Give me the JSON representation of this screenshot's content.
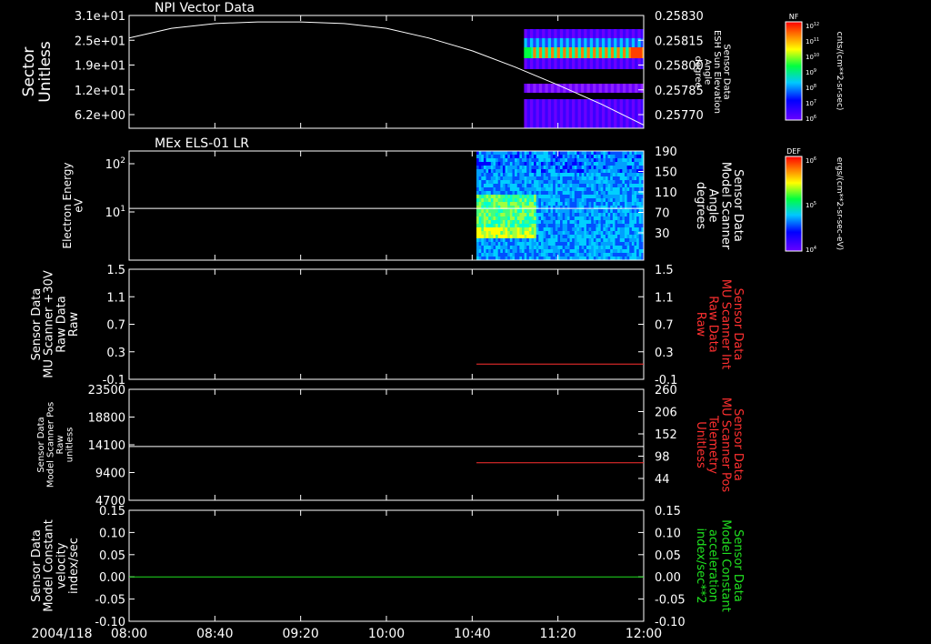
{
  "chart_data": [
    {
      "type": "heatmap",
      "title": "NPI Vector Data",
      "ylabel": "Sector\nUnitless",
      "y_ticks": [
        "3.1e+01",
        "2.5e+01",
        "1.9e+01",
        "1.2e+01",
        "6.2e+00"
      ],
      "ylim": [
        0,
        31
      ],
      "right_ylabel": "Sensor Data\nESH Sun Elevation\nAngle\ndegree",
      "right_ticks": [
        "0.25830",
        "0.25815",
        "0.25800",
        "0.25785",
        "0.25770"
      ],
      "right_ylim": [
        0.2576,
        0.2583
      ],
      "line": {
        "color": "#ffffff",
        "x_hours": [
          8.0,
          8.33,
          8.67,
          9.0,
          9.33,
          9.67,
          10.0,
          10.33,
          10.67,
          11.0,
          11.33,
          11.67,
          12.0
        ],
        "y": [
          0.25816,
          0.25822,
          0.25825,
          0.25826,
          0.25826,
          0.25825,
          0.25822,
          0.25816,
          0.25808,
          0.25798,
          0.25787,
          0.25775,
          0.25762
        ]
      },
      "data_start_hour": 11.07,
      "colorbar": {
        "label": "NF",
        "ticks": [
          "10^12",
          "10^11",
          "10^10",
          "10^9",
          "10^8",
          "10^7",
          "10^6"
        ],
        "units": "cnts/(cm**2-sr-sec)"
      }
    },
    {
      "type": "heatmap",
      "title": "MEx ELS-01 LR",
      "ylabel": "Electron Energy\neV",
      "y_ticks": [
        "10^2",
        "10^1"
      ],
      "right_ylabel": "Sensor Data\nModel Scanner\nAngle\ndegrees",
      "right_ticks": [
        "190",
        "150",
        "110",
        "70",
        "30"
      ],
      "right_ylim": [
        0,
        190
      ],
      "line": {
        "color": "#ffffff",
        "y_value": 90
      },
      "data_start_hour": 10.7,
      "colorbar": {
        "label": "DEF",
        "ticks": [
          "10^6",
          "10^5",
          "10^4"
        ],
        "units": "ergs/(cm**2-sr-sec-eV)"
      }
    },
    {
      "type": "line",
      "ylabel": "Sensor Data\nMU Scanner +30V\nRaw Data\nRaw",
      "y_ticks": [
        "1.5",
        "1.1",
        "0.7",
        "0.3",
        "-0.1"
      ],
      "ylim": [
        -0.3,
        1.5
      ],
      "right_ylabel": "Sensor Data\nMU Scanner Int\nRaw Data\nRaw",
      "right_ticks": [
        "1.5",
        "1.1",
        "0.7",
        "0.3",
        "-0.1"
      ],
      "right_ylim": [
        -0.3,
        1.5
      ],
      "series": [
        {
          "color": "#ff3030",
          "axis": "right",
          "x_hours": [
            10.7,
            12.0
          ],
          "y": [
            -0.05,
            -0.05
          ]
        }
      ]
    },
    {
      "type": "line",
      "ylabel": "Sensor Data\nModel Scanner Pos\nRaw\nunitless",
      "y_ticks": [
        "23500",
        "18800",
        "14100",
        "9400",
        "4700"
      ],
      "ylim": [
        0,
        23500
      ],
      "right_ylabel": "Sensor Data\nMU Scanner Pos\nTelemetry\nUnitless",
      "right_ticks": [
        "260",
        "206",
        "152",
        "98",
        "44"
      ],
      "right_ylim": [
        0,
        260
      ],
      "series": [
        {
          "color": "#ffffff",
          "axis": "left",
          "x_hours": [
            8.0,
            12.0
          ],
          "y": [
            11400,
            11400
          ]
        },
        {
          "color": "#ff3030",
          "axis": "right",
          "x_hours": [
            10.7,
            12.0
          ],
          "y": [
            88,
            88
          ]
        }
      ]
    },
    {
      "type": "line",
      "ylabel": "Sensor Data\nModel Constant\nvelocity\nindex/sec",
      "y_ticks": [
        "0.15",
        "0.10",
        "0.05",
        "0.00",
        "-0.05",
        "-0.10"
      ],
      "ylim": [
        -0.1,
        0.15
      ],
      "right_ylabel": "Sensor Data\nModel Constant\nacceleration\nindex/sec**2",
      "right_ticks": [
        "0.15",
        "0.10",
        "0.05",
        "0.00",
        "-0.05",
        "-0.10"
      ],
      "right_ylim": [
        -0.1,
        0.15
      ],
      "series": [
        {
          "color": "#20e020",
          "axis": "left",
          "x_hours": [
            8.0,
            12.0
          ],
          "y": [
            0.0,
            0.0
          ]
        }
      ]
    }
  ],
  "x_axis": {
    "date": "2004/118",
    "ticks": [
      "08:00",
      "08:40",
      "09:20",
      "10:00",
      "10:40",
      "11:20",
      "12:00"
    ],
    "range_hours": [
      8.0,
      12.0
    ]
  },
  "colors": {
    "left_label": "#ffffff",
    "panel3_right": "#ff3030",
    "panel4_right": "#ff3030",
    "panel5_right": "#20e020"
  }
}
